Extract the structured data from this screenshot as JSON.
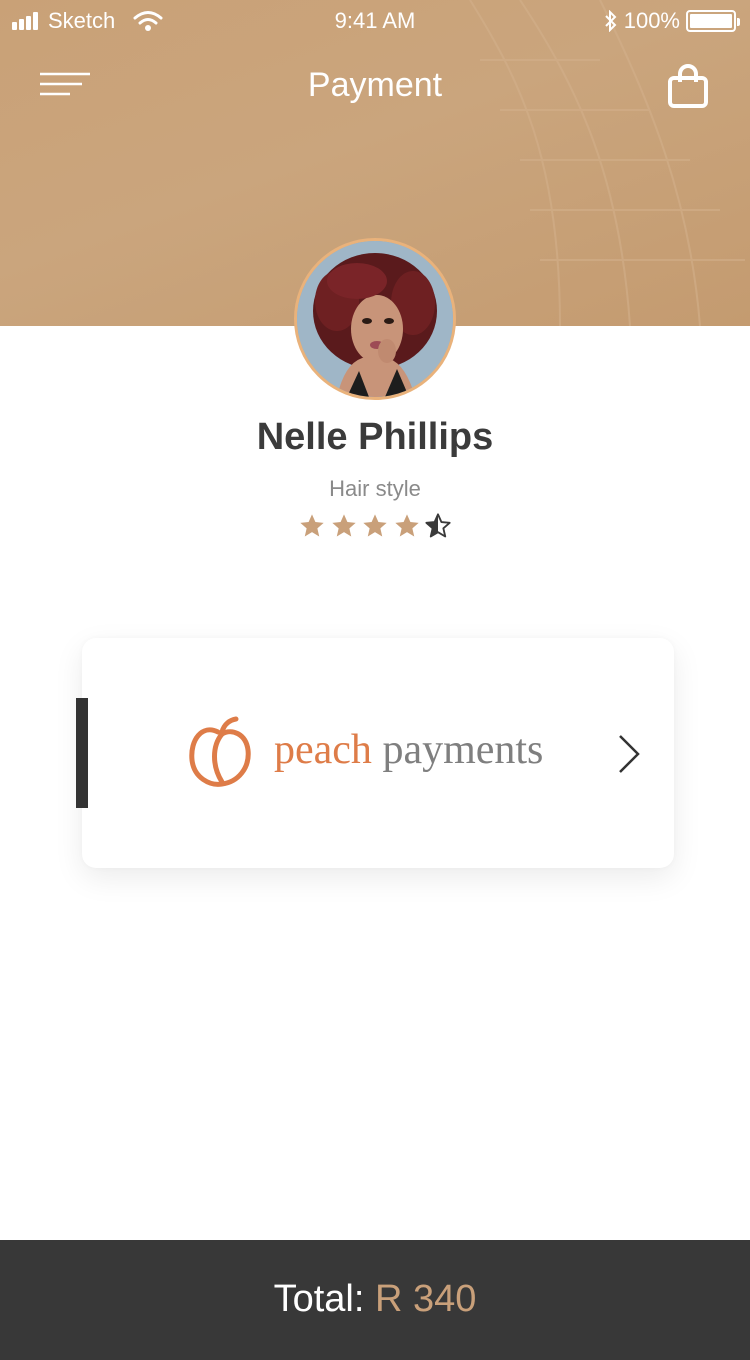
{
  "status_bar": {
    "carrier": "Sketch",
    "time": "9:41 AM",
    "battery": "100%"
  },
  "header": {
    "title": "Payment",
    "menu_icon": "menu-icon",
    "cart_icon": "shopping-bag-icon"
  },
  "profile": {
    "name": "Nelle Phillips",
    "service": "Hair style",
    "rating": 4.5,
    "rating_max": 5
  },
  "payment_method": {
    "brand_word_1": "peach",
    "brand_word_2": "payments",
    "icon": "peach-logo-icon"
  },
  "footer": {
    "total_label": "Total:",
    "total_amount": "R 340"
  },
  "colors": {
    "header_tan": "#c9a177",
    "accent": "#c9a07a",
    "peach_orange": "#de7c48",
    "footer_dark": "#383838",
    "text_dark": "#3b3b3b"
  }
}
